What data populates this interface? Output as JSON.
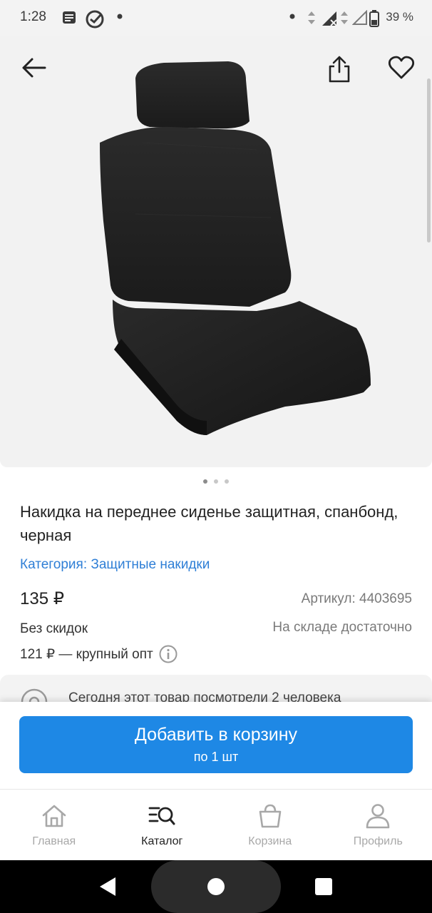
{
  "status_bar": {
    "time": "1:28",
    "battery": "39 %"
  },
  "product": {
    "title": "Накидка на переднее сиденье защитная, спанбонд, черная",
    "category": "Категория: Защитные накидки",
    "price": "135 ₽",
    "article": "Артикул: 4403695",
    "discount_note": "Без скидок",
    "stock": "На складе достаточно",
    "wholesale": "121 ₽ — крупный опт",
    "viewers": "Сегодня этот товар посмотрели 2 человека",
    "image_icon": "car-seat-cover-image",
    "gallery_count": 3,
    "gallery_active": 1
  },
  "actions": {
    "add_to_cart": "Добавить в корзину",
    "add_to_cart_sub": "по 1 шт"
  },
  "tabs": [
    {
      "label": "Главная",
      "icon": "home-icon",
      "active": false
    },
    {
      "label": "Каталог",
      "icon": "catalog-search-icon",
      "active": true
    },
    {
      "label": "Корзина",
      "icon": "basket-icon",
      "active": false
    },
    {
      "label": "Профиль",
      "icon": "profile-icon",
      "active": false
    }
  ],
  "colors": {
    "accent": "#1e88e5",
    "link": "#2f7fd6",
    "inactive_tab": "#a8a8a8"
  }
}
